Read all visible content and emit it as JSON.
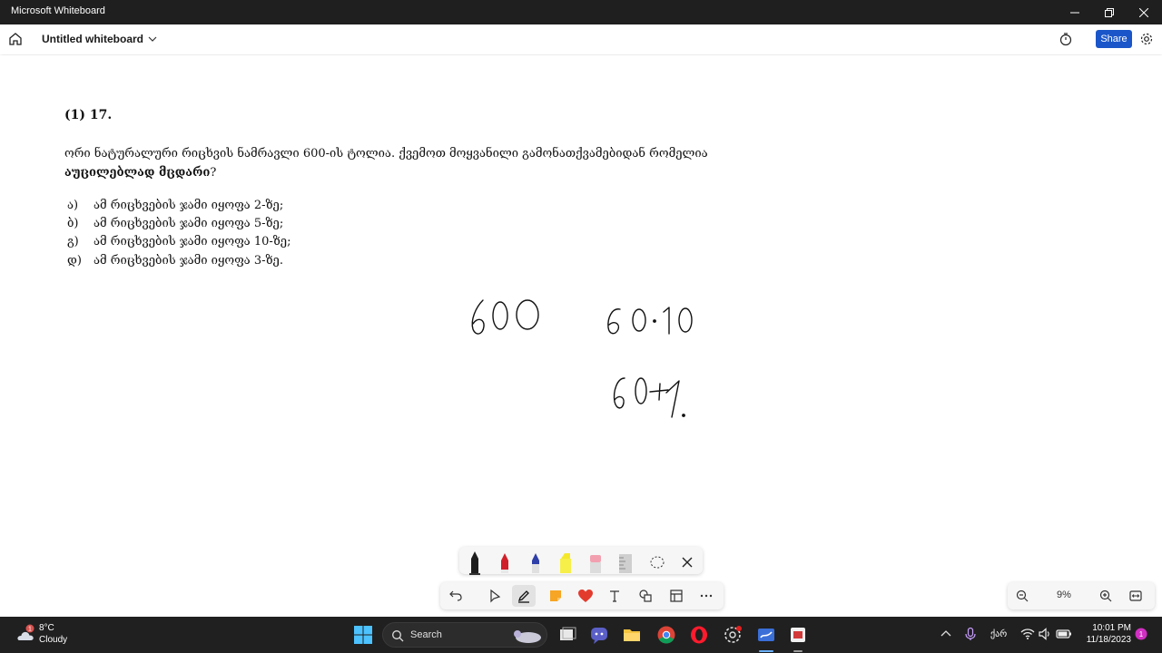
{
  "window": {
    "title": "Microsoft Whiteboard"
  },
  "header": {
    "board_title": "Untitled whiteboard",
    "share_label": "Share"
  },
  "question": {
    "number": "(1) 17.",
    "line1": "ორი ნატურალური რიცხვის ნამრავლი 600-ის ტოლია. ქვემოთ მოყვანილი გამონათქვამებიდან რომელია",
    "line2_bold": "აუცილებლად მცდარი",
    "line2_tail": "?",
    "options": [
      {
        "label": "ა)",
        "text": "ამ რიცხვების ჯამი იყოფა 2-ზე;"
      },
      {
        "label": "ბ)",
        "text": "ამ რიცხვების ჯამი იყოფა 5-ზე;"
      },
      {
        "label": "გ)",
        "text": "ამ რიცხვების ჯამი იყოფა 10-ზე;"
      },
      {
        "label": "დ)",
        "text": "ამ რიცხვების ჯამი იყოფა 3-ზე."
      }
    ]
  },
  "ink_notes": [
    "600",
    "60·10",
    "60+1."
  ],
  "zoom": {
    "level": "9%"
  },
  "taskbar": {
    "weather_temp": "8°C",
    "weather_condition": "Cloudy",
    "weather_badge": "1",
    "search_label": "Search",
    "language": "ქარ",
    "time": "10:01 PM",
    "date": "11/18/2023",
    "notification_badge": "1"
  },
  "colors": {
    "titlebar": "#1f1f1f",
    "share": "#1a56c9",
    "taskbar": "#202020",
    "accent": "#6ab0ff"
  }
}
